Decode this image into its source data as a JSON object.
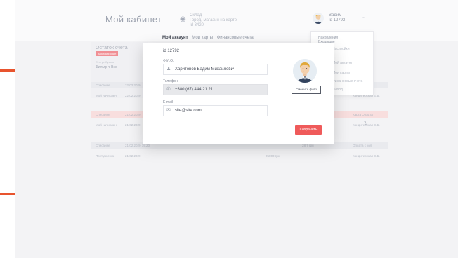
{
  "header": {
    "title": "Мой кабинет",
    "shop_line1": "Склад",
    "shop_line2": "Город, магазин на карте",
    "shop_line3": "Id 3420",
    "user_name": "Вадим",
    "user_id": "Id 12792"
  },
  "dropdown": {
    "head1": "Накопления",
    "head2": "Входящие",
    "items": [
      "Настройки",
      "Мой аккаунт",
      "Мои карты",
      "Финансовые счета",
      "Выход"
    ]
  },
  "balance": {
    "title": "Остаток счета",
    "badge": "Заблокирован",
    "labels": "Статус   Сумма",
    "filter": "Фильтр ▾   Все"
  },
  "table": {
    "rows": [
      {
        "c1": "Списание",
        "c2": "22.02.2020",
        "c3": "Вычисления",
        "c4": "Кондитер и Ко"
      },
      {
        "c1": "Мой начислен",
        "c2": "22.02.2020",
        "c3": "",
        "c4": "Кондитерская Е.Б."
      },
      {
        "c1": "Списание",
        "c2": "21.02.2020",
        "c3": "",
        "c4": "Карта Оплата"
      },
      {
        "c1": "Мой начислен",
        "c2": "21.02.2020",
        "c3": "",
        "c4": "Кондитерская Е.Б."
      },
      {
        "c1": "Списание",
        "c2": "21.02.2020 19:20",
        "c3": "28.7 грн",
        "c4": "Оплата с кол"
      },
      {
        "c1": "Поступление",
        "c2": "21.02.2020",
        "c3": "25000 грн",
        "c4": "Кондитерская Е.Б."
      }
    ]
  },
  "modal": {
    "tabs": [
      "Мой аккаунт",
      "Мои карты",
      "Финансовые счета"
    ],
    "active_tab": 0,
    "account_id": "id 12792",
    "name_label": "Ф.И.О.",
    "name_value": "Харитонов Вадим Михайлович",
    "phone_label": "Телефон",
    "phone_value": "+380 (67) 444 21 21",
    "email_label": "E-mail",
    "email_value": "site@site.com",
    "photo_button": "Сменить фото",
    "save_button": "Сохранить"
  }
}
